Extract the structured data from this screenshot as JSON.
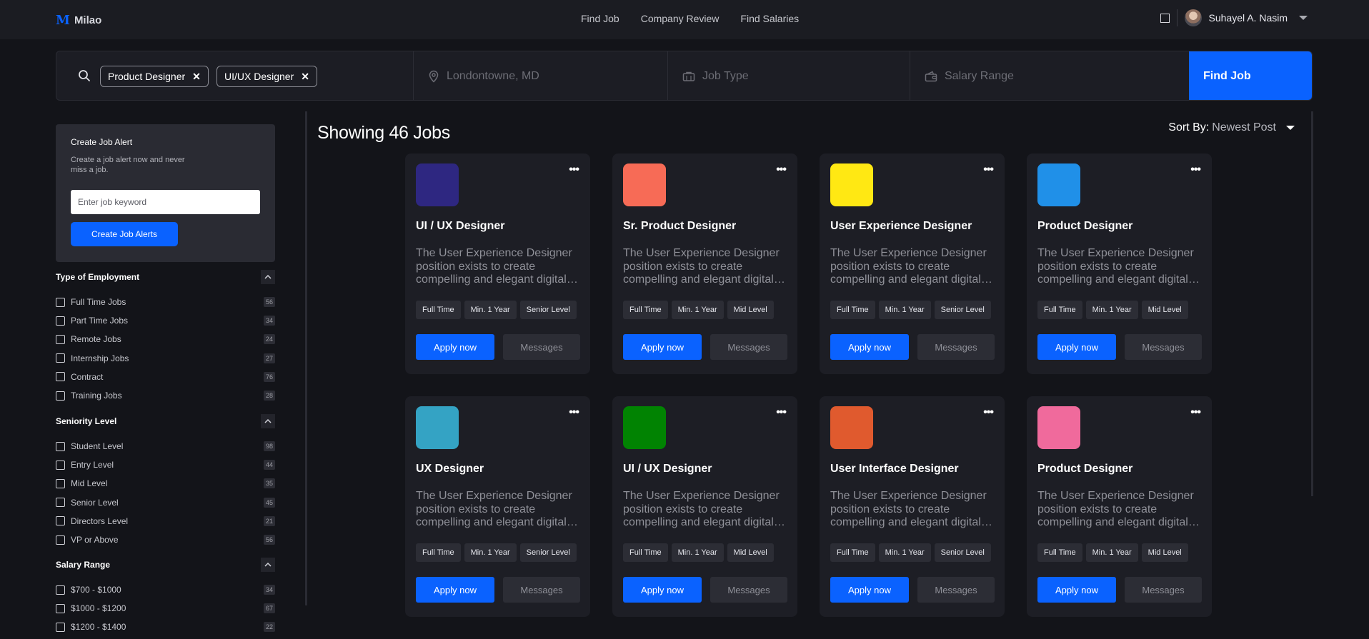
{
  "nav": {
    "logo_mark": "M",
    "logo_text": "Milao",
    "links": [
      "Find Job",
      "Company Review",
      "Find Salaries"
    ],
    "user_name": "Suhayel A. Nasim"
  },
  "search": {
    "keywords": [
      "Product Designer",
      "UI/UX Designer"
    ],
    "location_placeholder": "Londontowne, MD",
    "job_type_placeholder": "Job Type",
    "salary_placeholder": "Salary Range",
    "find_label": "Find Job"
  },
  "alert": {
    "title": "Create Job Alert",
    "desc": "Create a job alert now and never miss a job.",
    "input_placeholder": "Enter job keyword",
    "button": "Create Job Alerts"
  },
  "filters": [
    {
      "title": "Type of Employment",
      "items": [
        {
          "label": "Full Time Jobs",
          "count": "56"
        },
        {
          "label": "Part Time Jobs",
          "count": "34"
        },
        {
          "label": "Remote Jobs",
          "count": "24"
        },
        {
          "label": "Internship Jobs",
          "count": "27"
        },
        {
          "label": "Contract",
          "count": "76"
        },
        {
          "label": "Training Jobs",
          "count": "28"
        }
      ]
    },
    {
      "title": "Seniority Level",
      "items": [
        {
          "label": "Student Level",
          "count": "98"
        },
        {
          "label": "Entry Level",
          "count": "44"
        },
        {
          "label": "Mid Level",
          "count": "35"
        },
        {
          "label": "Senior Level",
          "count": "45"
        },
        {
          "label": "Directors Level",
          "count": "21"
        },
        {
          "label": "VP or Above",
          "count": "56"
        }
      ]
    },
    {
      "title": "Salary Range",
      "items": [
        {
          "label": "$700 - $1000",
          "count": "34"
        },
        {
          "label": "$1000 - $1200",
          "count": "67"
        },
        {
          "label": "$1200 - $1400",
          "count": "22"
        }
      ]
    }
  ],
  "main": {
    "showing": "Showing 46 Jobs",
    "sort_label": "Sort By:",
    "sort_value": "Newest Post"
  },
  "card_common": {
    "desc": "The User Experience Designer position exists to create compelling and elegant digital user experiences",
    "apply": "Apply now",
    "messages": "Messages"
  },
  "jobs": [
    {
      "title": "UI / UX Designer",
      "color": "#2e2781",
      "tags": [
        "Full Time",
        "Min. 1 Year",
        "Senior Level"
      ]
    },
    {
      "title": "Sr. Product Designer",
      "color": "#f76b56",
      "tags": [
        "Full Time",
        "Min. 1 Year",
        "Mid Level"
      ]
    },
    {
      "title": "User Experience Designer",
      "color": "#ffe813",
      "tags": [
        "Full Time",
        "Min. 1 Year",
        "Senior Level"
      ]
    },
    {
      "title": "Product Designer",
      "color": "#2090e8",
      "tags": [
        "Full Time",
        "Min. 1 Year",
        "Mid Level"
      ]
    },
    {
      "title": "UX Designer",
      "color": "#34a3c4",
      "tags": [
        "Full Time",
        "Min. 1 Year",
        "Senior Level"
      ]
    },
    {
      "title": "UI / UX Designer",
      "color": "#018302",
      "tags": [
        "Full Time",
        "Min. 1 Year",
        "Mid Level"
      ]
    },
    {
      "title": "User Interface Designer",
      "color": "#e05a2e",
      "tags": [
        "Full Time",
        "Min. 1 Year",
        "Senior Level"
      ]
    },
    {
      "title": "Product Designer",
      "color": "#f06a9c",
      "tags": [
        "Full Time",
        "Min. 1 Year",
        "Mid Level"
      ]
    }
  ]
}
